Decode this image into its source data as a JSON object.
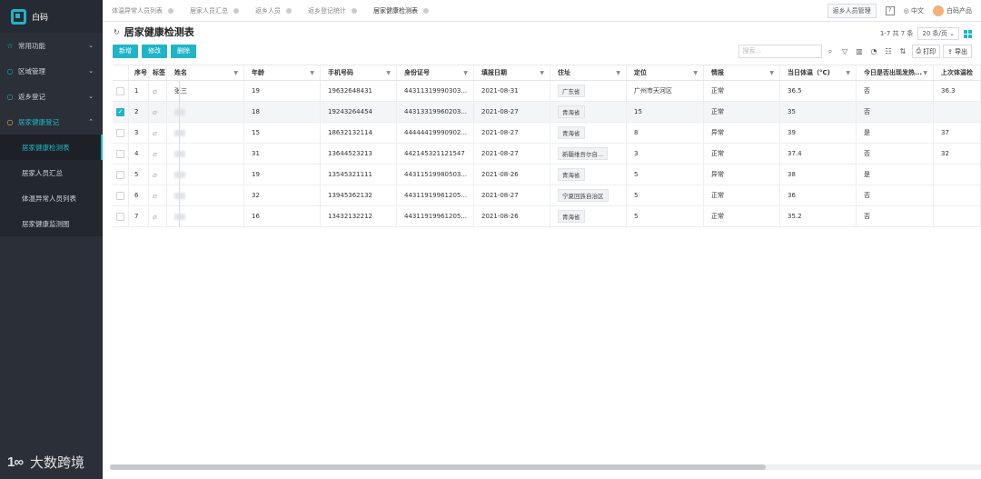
{
  "app": {
    "name": "白码"
  },
  "sidebar": {
    "menus": [
      {
        "label": "常用功能",
        "icon": "star-icon",
        "open": false
      },
      {
        "label": "区域管理",
        "icon": "dot-icon",
        "open": false
      },
      {
        "label": "返乡登记",
        "icon": "dot-icon",
        "open": false
      },
      {
        "label": "居家健康登记",
        "icon": "dot-icon",
        "open": true
      }
    ],
    "submenu": [
      {
        "label": "居家健康检测表",
        "active": true
      },
      {
        "label": "居家人员汇总",
        "active": false
      },
      {
        "label": "体温异常人员列表",
        "active": false
      },
      {
        "label": "居家健康监测图",
        "active": false
      }
    ],
    "watermark": {
      "logo": "1∞",
      "text": "大数跨境"
    }
  },
  "tabs": [
    {
      "label": "体温异常人员列表",
      "active": false
    },
    {
      "label": "居家人员汇总",
      "active": false
    },
    {
      "label": "返乡人员",
      "active": false
    },
    {
      "label": "返乡登记统计",
      "active": false
    },
    {
      "label": "居家健康检测表",
      "active": true
    }
  ],
  "topbar": {
    "manage_button": "返乡人员管理",
    "help": "?",
    "language": "中文",
    "user": "白码产品"
  },
  "page": {
    "title": "居家健康检测表",
    "pager_text": "1-7 共 7 条",
    "page_size": "20 条/页"
  },
  "actions": {
    "add": "新增",
    "edit": "修改",
    "delete": "删除"
  },
  "toolbar": {
    "search_placeholder": "搜索...",
    "print": "打印",
    "export": "导出"
  },
  "table": {
    "columns": [
      "序号",
      "标签",
      "姓名",
      "年龄",
      "手机号码",
      "身份证号",
      "填报日期",
      "住址",
      "定位",
      "情报",
      "当日体温（°C)",
      "今日是否出现发热...",
      "上次体温检"
    ],
    "rows": [
      {
        "idx": "1",
        "checked": false,
        "name": "张三",
        "name_blurred": false,
        "age": "19",
        "phone": "19632648431",
        "id_no": "44311319990303...",
        "date": "2021-08-31",
        "addr": "广东省",
        "loc": "广州市天河区",
        "status": "正常",
        "temp": "36.5",
        "fever": "否",
        "last": "36.3"
      },
      {
        "idx": "2",
        "checked": true,
        "name": "",
        "name_blurred": true,
        "age": "18",
        "phone": "19243264454",
        "id_no": "44313319960203...",
        "date": "2021-08-27",
        "addr": "青海省",
        "loc": "15",
        "status": "正常",
        "temp": "35",
        "fever": "否",
        "last": ""
      },
      {
        "idx": "3",
        "checked": false,
        "name": "",
        "name_blurred": true,
        "age": "15",
        "phone": "18632132114",
        "id_no": "44444419990902...",
        "date": "2021-08-27",
        "addr": "青海省",
        "loc": "8",
        "status": "异常",
        "temp": "39",
        "fever": "是",
        "last": "37"
      },
      {
        "idx": "4",
        "checked": false,
        "name": "",
        "name_blurred": true,
        "age": "31",
        "phone": "13644523213",
        "id_no": "442145321121547",
        "date": "2021-08-27",
        "addr": "新疆维吾尔自...",
        "loc": "3",
        "status": "正常",
        "temp": "37.4",
        "fever": "否",
        "last": "32"
      },
      {
        "idx": "5",
        "checked": false,
        "name": "",
        "name_blurred": true,
        "age": "19",
        "phone": "13545321111",
        "id_no": "44311519980503...",
        "date": "2021-08-26",
        "addr": "青海省",
        "loc": "5",
        "status": "异常",
        "temp": "38",
        "fever": "是",
        "last": ""
      },
      {
        "idx": "6",
        "checked": false,
        "name": "",
        "name_blurred": true,
        "age": "32",
        "phone": "13945362132",
        "id_no": "44311919961205...",
        "date": "2021-08-27",
        "addr": "宁夏回族自治区",
        "loc": "5",
        "status": "正常",
        "temp": "36",
        "fever": "否",
        "last": ""
      },
      {
        "idx": "7",
        "checked": false,
        "name": "",
        "name_blurred": true,
        "age": "16",
        "phone": "13432132212",
        "id_no": "44311919961205...",
        "date": "2021-08-26",
        "addr": "青海省",
        "loc": "5",
        "status": "正常",
        "temp": "35.2",
        "fever": "否",
        "last": ""
      }
    ]
  },
  "colors": {
    "accent": "#1fb5c8",
    "sidebar_bg": "#2b2f38",
    "active_menu_icon": "#e6c25a"
  }
}
